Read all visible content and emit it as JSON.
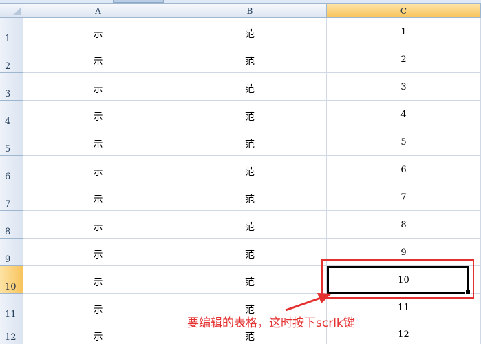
{
  "columns": [
    "A",
    "B",
    "C"
  ],
  "selected_column": "C",
  "rows": [
    {
      "num": "1",
      "a": "示",
      "b": "范",
      "c": "1"
    },
    {
      "num": "2",
      "a": "示",
      "b": "范",
      "c": "2"
    },
    {
      "num": "3",
      "a": "示",
      "b": "范",
      "c": "3"
    },
    {
      "num": "4",
      "a": "示",
      "b": "范",
      "c": "4"
    },
    {
      "num": "5",
      "a": "示",
      "b": "范",
      "c": "5"
    },
    {
      "num": "6",
      "a": "示",
      "b": "范",
      "c": "6"
    },
    {
      "num": "7",
      "a": "示",
      "b": "范",
      "c": "7"
    },
    {
      "num": "8",
      "a": "示",
      "b": "范",
      "c": "8"
    },
    {
      "num": "9",
      "a": "示",
      "b": "范",
      "c": "9"
    },
    {
      "num": "10",
      "a": "示",
      "b": "范",
      "c": "10"
    },
    {
      "num": "11",
      "a": "示",
      "b": "范",
      "c": "11"
    },
    {
      "num": "12",
      "a": "示",
      "b": "范",
      "c": "12"
    }
  ],
  "active_cell": "C10",
  "annotation": {
    "text": "要编辑的表格，这时按下scrlk键",
    "color": "#e53030"
  },
  "colors": {
    "header_selected": "#f8c45d",
    "grid_line": "#d0d7e5",
    "header_border": "#9eb6ce"
  }
}
